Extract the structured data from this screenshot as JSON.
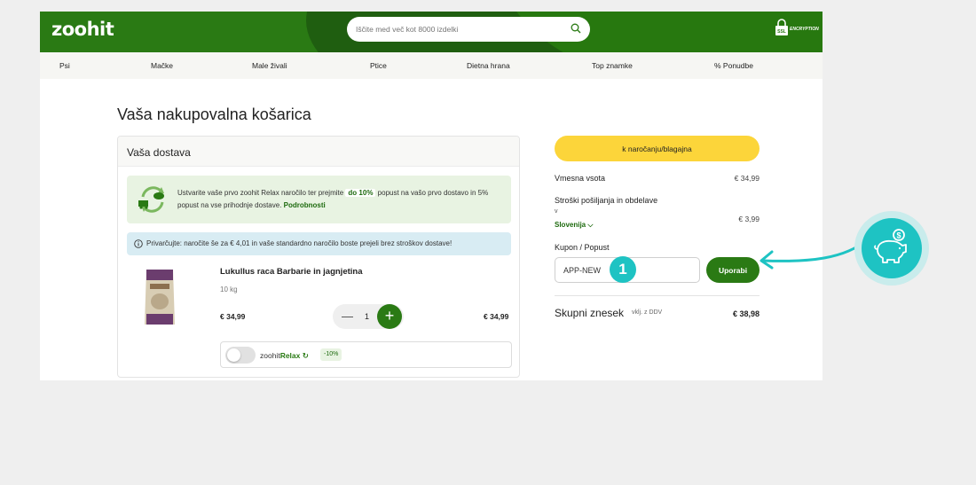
{
  "header": {
    "logo": "zoohit",
    "search_placeholder": "Iščite med več kot 8000 izdelki",
    "ssl_text": "ENCRYPTION",
    "ssl_badge": "SSL"
  },
  "nav": {
    "items": [
      "Psi",
      "Mačke",
      "Male živali",
      "Ptice",
      "Dietna hrana",
      "Top znamke",
      "% Ponudbe"
    ]
  },
  "page": {
    "title": "Vaša nakupovalna košarica"
  },
  "delivery": {
    "heading": "Vaša dostava",
    "relax_text_1": "Ustvarite vaše prvo zoohit Relax naročilo ter prejmite",
    "relax_highlight": "do 10%",
    "relax_text_2": "popust na vašo prvo dostavo in 5% popust na vse prihodnje dostave.",
    "relax_link": "Podrobnosti",
    "info_text": "Privarčujte:  naročite še za € 4,01 in vaše standardno naročilo boste prejeli brez stroškov dostave!"
  },
  "product": {
    "name": "Lukullus raca Barbarie in jagnjetina",
    "weight": "10 kg",
    "price": "€ 34,99",
    "quantity": "1",
    "total": "€ 34,99",
    "relax_brand_prefix": "zoohit",
    "relax_brand": "Relax",
    "relax_discount": "-10%"
  },
  "summary": {
    "checkout_label": "k naročanju/blagajna",
    "subtotal_label": "Vmesna vsota",
    "subtotal_value": "€ 34,99",
    "shipping_label": "Stroški pošiljanja in obdelave",
    "shipping_v": "v",
    "shipping_country": "Slovenija",
    "shipping_value": "€ 3,99",
    "coupon_label": "Kupon / Popust",
    "coupon_value": "APP-NEW",
    "apply_label": "Uporabi",
    "total_label": "Skupni znesek",
    "total_vat": "vklj. z DDV",
    "total_value": "€ 38,98"
  },
  "annotation": {
    "step_number": "1"
  },
  "colors": {
    "brand_green": "#2a7a14",
    "checkout_yellow": "#fcd53a",
    "annotation_teal": "#1ec3c3"
  }
}
